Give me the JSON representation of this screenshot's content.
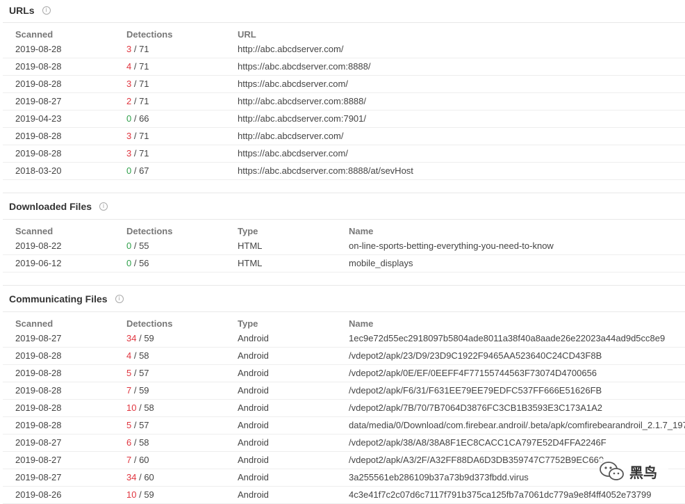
{
  "urls": {
    "title": "URLs",
    "headers": [
      "Scanned",
      "Detections",
      "URL"
    ],
    "rows": [
      {
        "scanned": "2019-08-28",
        "detected": "3",
        "total": "71",
        "url": "http://abc.abcdserver.com/"
      },
      {
        "scanned": "2019-08-28",
        "detected": "4",
        "total": "71",
        "url": "https://abc.abcdserver.com:8888/"
      },
      {
        "scanned": "2019-08-28",
        "detected": "3",
        "total": "71",
        "url": "https://abc.abcdserver.com/"
      },
      {
        "scanned": "2019-08-27",
        "detected": "2",
        "total": "71",
        "url": "http://abc.abcdserver.com:8888/"
      },
      {
        "scanned": "2019-04-23",
        "detected": "0",
        "total": "66",
        "url": "http://abc.abcdserver.com:7901/"
      },
      {
        "scanned": "2019-08-28",
        "detected": "3",
        "total": "71",
        "url": "http://abc.abcdserver.com/"
      },
      {
        "scanned": "2019-08-28",
        "detected": "3",
        "total": "71",
        "url": "https://abc.abcdserver.com/"
      },
      {
        "scanned": "2018-03-20",
        "detected": "0",
        "total": "67",
        "url": "https://abc.abcdserver.com:8888/at/sevHost"
      }
    ]
  },
  "downloaded_files": {
    "title": "Downloaded Files",
    "headers": [
      "Scanned",
      "Detections",
      "Type",
      "Name"
    ],
    "rows": [
      {
        "scanned": "2019-08-22",
        "detected": "0",
        "total": "55",
        "type": "HTML",
        "name": "on-line-sports-betting-everything-you-need-to-know"
      },
      {
        "scanned": "2019-06-12",
        "detected": "0",
        "total": "56",
        "type": "HTML",
        "name": "mobile_displays"
      }
    ]
  },
  "communicating_files": {
    "title": "Communicating Files",
    "headers": [
      "Scanned",
      "Detections",
      "Type",
      "Name"
    ],
    "rows": [
      {
        "scanned": "2019-08-27",
        "detected": "34",
        "total": "59",
        "type": "Android",
        "name": "1ec9e72d55ec2918097b5804ade8011a38f40a8aade26e22023a44ad9d5cc8e9"
      },
      {
        "scanned": "2019-08-28",
        "detected": "4",
        "total": "58",
        "type": "Android",
        "name": "/vdepot2/apk/23/D9/23D9C1922F9465AA523640C24CD43F8B"
      },
      {
        "scanned": "2019-08-28",
        "detected": "5",
        "total": "57",
        "type": "Android",
        "name": "/vdepot2/apk/0E/EF/0EEFF4F77155744563F73074D4700656"
      },
      {
        "scanned": "2019-08-28",
        "detected": "7",
        "total": "59",
        "type": "Android",
        "name": "/vdepot2/apk/F6/31/F631EE79EE79EDFC537FF666E51626FB"
      },
      {
        "scanned": "2019-08-28",
        "detected": "10",
        "total": "58",
        "type": "Android",
        "name": "/vdepot2/apk/7B/70/7B7064D3876FC3CB1B3593E3C173A1A2"
      },
      {
        "scanned": "2019-08-28",
        "detected": "5",
        "total": "57",
        "type": "Android",
        "name": "data/media/0/Download/com.firebear.androil/.beta/apk/comfirebearandroil_2.1.7_197"
      },
      {
        "scanned": "2019-08-27",
        "detected": "6",
        "total": "58",
        "type": "Android",
        "name": "/vdepot2/apk/38/A8/38A8F1EC8CACC1CA797E52D4FFA2246F"
      },
      {
        "scanned": "2019-08-27",
        "detected": "7",
        "total": "60",
        "type": "Android",
        "name": "/vdepot2/apk/A3/2F/A32FF88DA6D3DB359747C7752B9EC660"
      },
      {
        "scanned": "2019-08-27",
        "detected": "34",
        "total": "60",
        "type": "Android",
        "name": "3a255561eb286109b37a73b9d373fbdd.virus"
      },
      {
        "scanned": "2019-08-26",
        "detected": "10",
        "total": "59",
        "type": "Android",
        "name": "4c3e41f7c2c07d6c7117f791b375ca125fb7a7061dc779a9e8f4ff4052e73799"
      }
    ]
  },
  "watermark": {
    "text": "黑鸟",
    "icon": "wechat-icon"
  },
  "colors": {
    "positive": "#e0353f",
    "zero": "#2fa04a",
    "header": "#777777",
    "text": "#444444"
  }
}
